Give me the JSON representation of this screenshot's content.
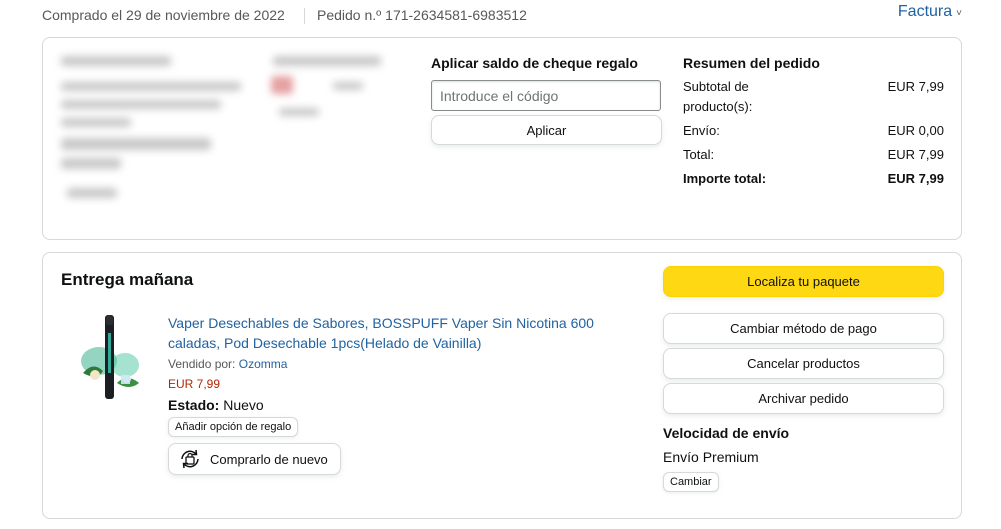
{
  "header": {
    "date_text": "Comprado el 29 de noviembre de 2022",
    "order_text": "Pedido n.º 171-2634581-6983512",
    "invoice_label": "Factura",
    "invoice_chevron": "˅"
  },
  "gift_card": {
    "title": "Aplicar saldo de cheque regalo",
    "input_placeholder": "Introduce el código",
    "input_value": "",
    "apply_label": "Aplicar"
  },
  "summary": {
    "title": "Resumen del pedido",
    "rows": [
      {
        "label": "Subtotal de producto(s):",
        "value": "EUR 7,99"
      },
      {
        "label": "Envío:",
        "value": "EUR 0,00"
      },
      {
        "label": "Total:",
        "value": "EUR 7,99"
      },
      {
        "label": "Importe total:",
        "value": "EUR 7,99"
      }
    ]
  },
  "delivery": {
    "title": "Entrega mañana",
    "product": {
      "title": "Vaper Desechables de Sabores, BOSSPUFF Vaper Sin Nicotina 600 caladas, Pod Desechable 1pcs(Helado de Vainilla)",
      "seller_prefix": "Vendido por:",
      "seller_name": "Ozomma",
      "price": "EUR 7,99",
      "state_label": "Estado:",
      "state_value": "Nuevo",
      "gift_option_label": "Añadir opción de regalo",
      "buy_again_label": "Comprarlo de nuevo"
    },
    "actions": {
      "locate": "Localiza tu paquete",
      "change_payment": "Cambiar método de pago",
      "cancel": "Cancelar productos",
      "archive": "Archivar pedido"
    },
    "shipping_speed": {
      "title": "Velocidad de envío",
      "value": "Envío Premium",
      "change_label": "Cambiar"
    }
  },
  "colors": {
    "link": "#2162a1",
    "price": "#b12704",
    "primary_button": "#ffd814",
    "border": "#d5d9d9"
  },
  "icons": {
    "invoice_chevron": "chevron-down-icon",
    "buy_again": "buy-again-icon"
  }
}
